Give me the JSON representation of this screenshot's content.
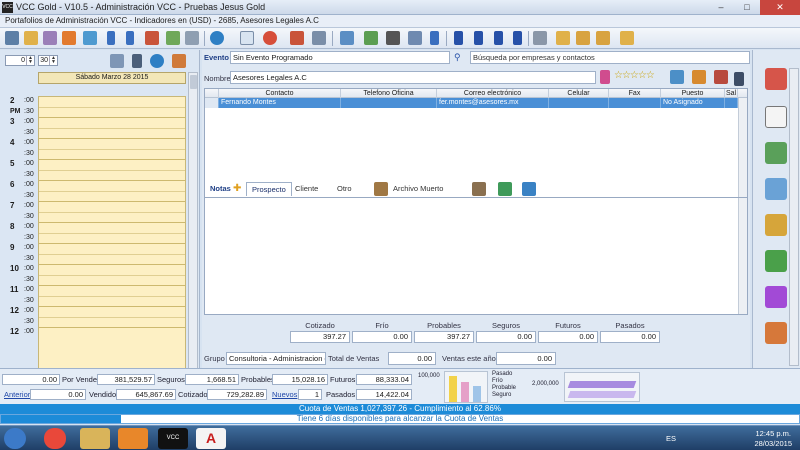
{
  "window": {
    "title": "VCC Gold - V10.5 - Administración VCC - Pruebas Jesus Gold",
    "logo_text": "VCC",
    "subtitle": "Portafolios de Administración VCC - Indicadores en (USD) - 2685, Asesores Legales A.C"
  },
  "colors": {
    "accent": "#1d8bd8",
    "selection": "#4a8fd6",
    "calendar_bg": "#fdf0c4",
    "close_button": "#c8463e"
  },
  "calendar": {
    "spin1": "0",
    "spin2": "30",
    "date_header": "Sábado Marzo 28 2015",
    "hour_labels": [
      "2",
      "PM",
      "3",
      "4",
      "5",
      "6",
      "7",
      "8",
      "9",
      "10",
      "11",
      "12"
    ],
    "minute_labels": [
      ":00",
      ":30"
    ]
  },
  "event": {
    "label": "Evento",
    "value": "Sin Evento Programado",
    "search_placeholder": "Búsqueda por empresas y contactos"
  },
  "company": {
    "label": "Nombre",
    "value": "Asesores Legales A.C"
  },
  "grid": {
    "columns": [
      "Contacto",
      "Telefono Oficina",
      "Correo electrónico",
      "Celular",
      "Fax",
      "Puesto",
      "Sal"
    ],
    "rows": [
      [
        "Fernando Montes",
        "",
        "fer.montes@asesores.mx",
        "",
        "",
        "No Asignado",
        ""
      ]
    ]
  },
  "tabs": {
    "notes": "Notas",
    "items": [
      "Prospecto",
      "Cliente",
      "Otro",
      "Archivo Muerto"
    ]
  },
  "stats": {
    "labels": [
      "Cotizado",
      "Frío",
      "Probables",
      "Seguros",
      "Futuros",
      "Pasados"
    ],
    "values": [
      "397.27",
      "0.00",
      "397.27",
      "0.00",
      "0.00",
      "0.00"
    ]
  },
  "group": {
    "label": "Grupo",
    "value": "Consultoria - Administracion de",
    "total_label": "Total de Ventas",
    "total_value": "0.00",
    "year_label": "Ventas este año",
    "year_value": "0.00"
  },
  "summary": {
    "row1": [
      {
        "value": "0.00",
        "label": "Por Vender"
      },
      {
        "value": "381,529.57",
        "label": "Seguros"
      },
      {
        "value": "1,668.51",
        "label": "Probables"
      },
      {
        "value": "15,028.16",
        "label": "Futuros"
      },
      {
        "value": "88,333.04"
      }
    ],
    "row2": [
      {
        "label": "Anterior",
        "value": "0.00"
      },
      {
        "label": "Vendido",
        "value": "645,867.69"
      },
      {
        "label": "Cotizado",
        "value": "729,282.89"
      },
      {
        "label": "Nuevos",
        "value": "1"
      },
      {
        "label": "Pasados",
        "value": "14,422.04"
      }
    ],
    "chart1_axis": "100,000",
    "chart1_legend": [
      "Pasado",
      "Frío",
      "Probable",
      "Seguro"
    ],
    "chart2_axis": "2,000,000"
  },
  "quota": {
    "line1": "Cuota de Ventas 1,027,397.26 - Cumplimiento al 62.86%",
    "line2": "Tiene 6 días disponibles para alcanzar la Cuota de Ventas",
    "progress_fraction": 0.15
  },
  "taskbar": {
    "lang": "ES",
    "time": "12:45 p.m.",
    "date": "28/03/2015"
  }
}
